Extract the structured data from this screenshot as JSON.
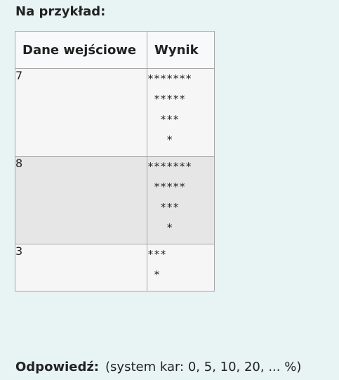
{
  "heading": "Na przykład:",
  "table": {
    "headers": {
      "input": "Dane wejściowe",
      "output": "Wynik"
    },
    "rows": [
      {
        "input": "7",
        "output": "*******\n *****\n  ***\n   *"
      },
      {
        "input": "8",
        "output": "*******\n *****\n  ***\n   *"
      },
      {
        "input": "3",
        "output": "***\n *"
      }
    ]
  },
  "answer": {
    "label": "Odpowiedź:",
    "hint": "(system kar: 0, 5, 10, 20, ... %)"
  }
}
